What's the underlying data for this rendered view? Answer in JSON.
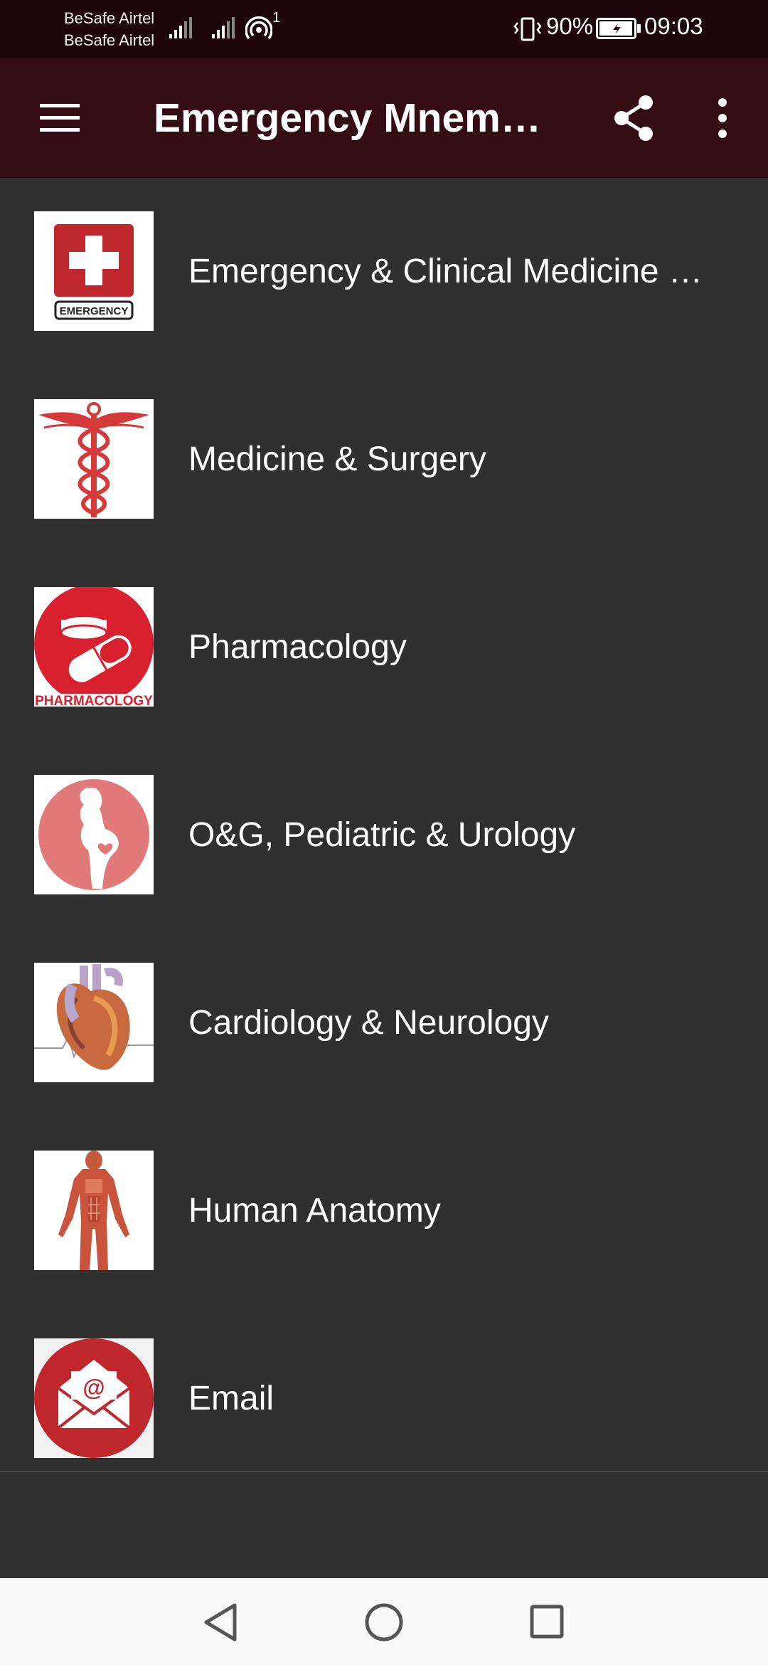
{
  "status_bar": {
    "carrier_1": "BeSafe Airtel",
    "carrier_2": "BeSafe Airtel",
    "hotspot_count": "1",
    "battery": "90%",
    "time": "09:03"
  },
  "app_bar": {
    "title": "Emergency Mnemonics",
    "menu_icon": "hamburger-menu-icon",
    "share_icon": "share-icon",
    "more_icon": "more-vert-icon"
  },
  "menu": {
    "items": [
      {
        "label": "Emergency & Clinical Medicine Mnemonics",
        "icon": "emergency-cross-icon"
      },
      {
        "label": "Medicine & Surgery",
        "icon": "caduceus-icon"
      },
      {
        "label": "Pharmacology",
        "icon": "pill-capsule-icon"
      },
      {
        "label": "O&G, Pediatric & Urology",
        "icon": "pregnancy-icon"
      },
      {
        "label": "Cardiology & Neurology",
        "icon": "heart-anatomy-icon"
      },
      {
        "label": "Human Anatomy",
        "icon": "muscle-anatomy-icon"
      },
      {
        "label": "Email",
        "icon": "email-envelope-icon"
      }
    ],
    "icon_text": {
      "emergency_badge": "EMERGENCY",
      "pharmacology_banner": "PHARMACOLOGY",
      "email_at": "@"
    }
  },
  "colors": {
    "status_bar_bg": "#1e070d",
    "app_bar_bg": "#340c14",
    "list_bg": "#303030",
    "accent_red": "#c0272d",
    "nav_bar_bg": "#fafafa"
  },
  "nav_bar": {
    "back_icon": "back-triangle-icon",
    "home_icon": "home-circle-icon",
    "recents_icon": "recents-square-icon"
  }
}
